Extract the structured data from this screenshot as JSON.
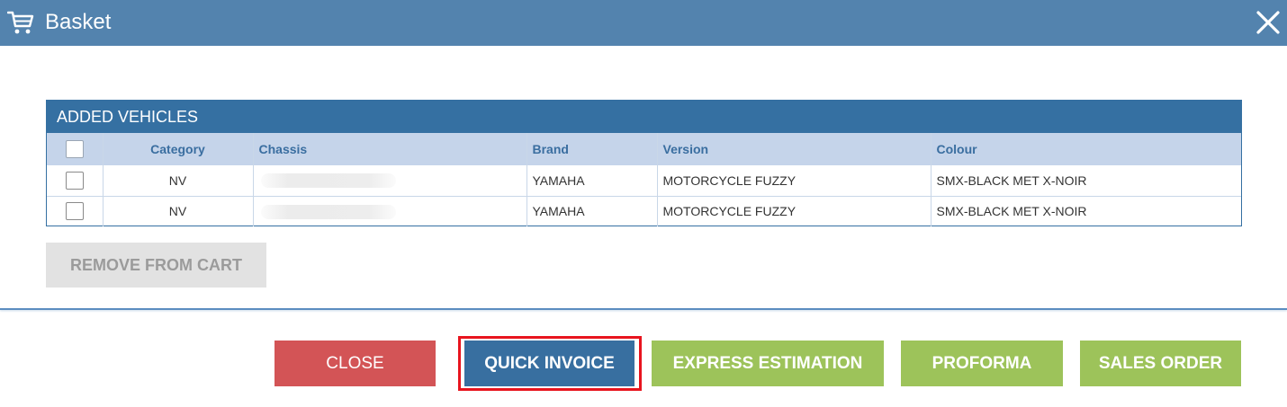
{
  "header": {
    "title": "Basket",
    "icon": "shopping-cart-icon",
    "close_icon": "close-icon"
  },
  "panel": {
    "title": "ADDED VEHICLES",
    "columns": [
      "",
      "Category",
      "Chassis",
      "Brand",
      "Version",
      "Colour"
    ],
    "rows": [
      {
        "checked": false,
        "category": "NV",
        "chassis": "",
        "brand": "YAMAHA",
        "version": "MOTORCYCLE FUZZY",
        "colour": "SMX-BLACK MET X-NOIR"
      },
      {
        "checked": false,
        "category": "NV",
        "chassis": "",
        "brand": "YAMAHA",
        "version": "MOTORCYCLE FUZZY",
        "colour": "SMX-BLACK MET X-NOIR"
      }
    ]
  },
  "actions": {
    "remove_from_cart": "REMOVE FROM CART",
    "close": "CLOSE",
    "quick_invoice": "QUICK INVOICE",
    "express_estimation": "EXPRESS ESTIMATION",
    "proforma": "PROFORMA",
    "sales_order": "SALES ORDER"
  },
  "colors": {
    "header_bg": "#5383ae",
    "panel_header_bg": "#3570a2",
    "column_header_bg": "#c5d4ea",
    "close_button": "#d35456",
    "quick_invoice_button": "#386fa0",
    "green_buttons": "#9dc35a",
    "highlight_border": "#e8141e"
  }
}
